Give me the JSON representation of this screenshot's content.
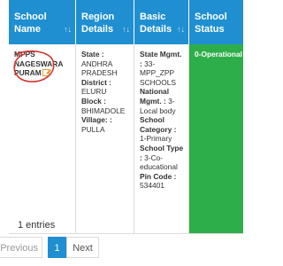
{
  "table": {
    "headers": [
      {
        "label": "School Name",
        "sort": "↑↓"
      },
      {
        "label": "Region Details",
        "sort": "↑↓"
      },
      {
        "label": "Basic Details",
        "sort": "↑↓"
      },
      {
        "label": "School Status",
        "sort": ""
      }
    ],
    "row": {
      "school_name": "MPPS NAGESWARA PURAM",
      "region": {
        "state_label": "State :",
        "state_value": "ANDHRA PRADESH",
        "district_label": "District :",
        "district_value": "ELURU",
        "block_label": "Block :",
        "block_value": "BHIMADOLE",
        "village_label": "Village: :",
        "village_value": "PULLA"
      },
      "basic": {
        "mgmt_label": "State Mgmt. :",
        "mgmt_value": "33-MPP_ZPP SCHOOLS",
        "national_label": "National Mgmt. :",
        "national_value": "3-Local body",
        "category_label": "School Category :",
        "category_value": "1-Primary",
        "type_label": "School Type :",
        "type_value": "3-Co-educational",
        "pin_label": "Pin Code :",
        "pin_value": "534401"
      },
      "status": "0-Operational"
    }
  },
  "footer": {
    "entries_text": "1 entries",
    "pagination": {
      "previous": "Previous",
      "current": "1",
      "next": "Next"
    }
  },
  "colors": {
    "header": "#1f8fd1",
    "status": "#2eae4b",
    "annotation": "#d0342c"
  }
}
